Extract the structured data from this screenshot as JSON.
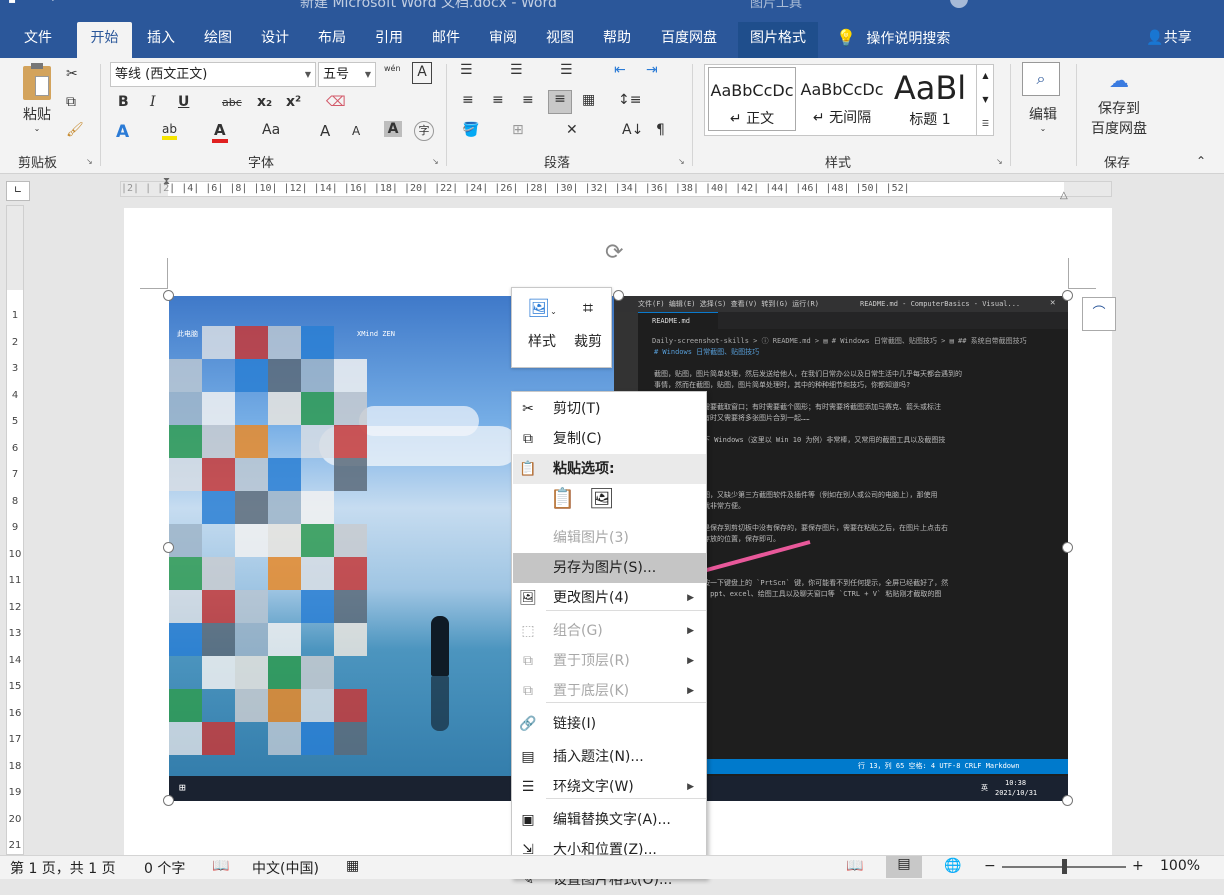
{
  "titlebar": {
    "doc_title": "新建 Microsoft Word 文档.docx - Word",
    "context_title": "图片工具"
  },
  "tabs": [
    "文件",
    "开始",
    "插入",
    "绘图",
    "设计",
    "布局",
    "引用",
    "邮件",
    "审阅",
    "视图",
    "帮助",
    "百度网盘",
    "图片格式"
  ],
  "active_tab": "开始",
  "tell_me": "操作说明搜索",
  "share": "共享",
  "clipboard": {
    "paste": "粘贴",
    "group": "剪贴板"
  },
  "font": {
    "name": "等线 (西文正文)",
    "size": "五号",
    "group": "字体",
    "bold": "B",
    "italic": "I",
    "underline": "U",
    "strike": "abc",
    "sub": "x₂",
    "sup": "x²",
    "grow": "A",
    "shrink": "A",
    "case": "Aa",
    "phonetic": "wén"
  },
  "paragraph": {
    "group": "段落"
  },
  "styles": {
    "group": "样式",
    "items": [
      {
        "sample": "AaBbCcDc",
        "name": "正文"
      },
      {
        "sample": "AaBbCcDc",
        "name": "无间隔"
      },
      {
        "sample": "AaBl",
        "name": "标题 1"
      }
    ]
  },
  "editing": {
    "label": "编辑"
  },
  "save": {
    "line1": "保存到",
    "line2": "百度网盘",
    "group": "保存"
  },
  "ruler_text": "|2|  |  |2|  |4|  |6|  |8|  |10|  |12|  |14|  |16|  |18|  |20|  |22|  |24|  |26|  |28|  |30|  |32|  |34|  |36|  |38|  |40|  |42|  |44|  |46|  |48|  |50|  |52|",
  "vruler_numbers": [
    "1",
    "2",
    "3",
    "4",
    "5",
    "6",
    "7",
    "8",
    "9",
    "10",
    "11",
    "12",
    "13",
    "14",
    "15",
    "16",
    "17",
    "18",
    "19",
    "20",
    "21"
  ],
  "minibar": {
    "style": "样式",
    "crop": "裁剪"
  },
  "context_menu": [
    {
      "label": "剪切(T)",
      "icon": "✂",
      "disabled": false,
      "sub": false
    },
    {
      "label": "复制(C)",
      "icon": "⧉",
      "disabled": false,
      "sub": false
    },
    {
      "label": "粘贴选项:",
      "icon": "📋",
      "disabled": false,
      "sub": false,
      "header": true
    },
    {
      "label": "编辑图片(3)",
      "icon": "",
      "disabled": true,
      "sub": false
    },
    {
      "label": "另存为图片(S)...",
      "icon": "",
      "disabled": false,
      "sub": false,
      "highlight": true
    },
    {
      "label": "更改图片(4)",
      "icon": "🖼",
      "disabled": false,
      "sub": true
    },
    {
      "label": "组合(G)",
      "icon": "⬚",
      "disabled": true,
      "sub": true
    },
    {
      "label": "置于顶层(R)",
      "icon": "⧉",
      "disabled": true,
      "sub": true
    },
    {
      "label": "置于底层(K)",
      "icon": "⧉",
      "disabled": true,
      "sub": true
    },
    {
      "label": "链接(I)",
      "icon": "🔗",
      "disabled": false,
      "sub": false
    },
    {
      "label": "插入题注(N)...",
      "icon": "▤",
      "disabled": false,
      "sub": false
    },
    {
      "label": "环绕文字(W)",
      "icon": "☰",
      "disabled": false,
      "sub": true
    },
    {
      "label": "编辑替换文字(A)...",
      "icon": "▣",
      "disabled": false,
      "sub": false
    },
    {
      "label": "大小和位置(Z)...",
      "icon": "⇲",
      "disabled": false,
      "sub": false
    },
    {
      "label": "设置图片格式(O)...",
      "icon": "✎",
      "disabled": false,
      "sub": false
    }
  ],
  "status": {
    "page": "第 1 页，共 1 页",
    "words": "0 个字",
    "lang": "中文(中国)",
    "zoom": "100%"
  },
  "screenshot": {
    "desktop_icons": [
      "此电脑",
      "",
      "",
      "",
      "XMind ZEN"
    ],
    "vscode_tab": "README.md",
    "vscode_title": "README.md - ComputerBasics - Visual...",
    "vscode_menu": "文件(F)  编辑(E)  选择(S)  查看(V)  转到(G)  运行(R)",
    "breadcrumb": "Daily-screenshot-skills > ⓘ README.md > ▤ # Windows 日常截图、贴图技巧 > ▤ ## 系统自带截图技巧",
    "code_lines": [
      "# Windows 日常截图、贴图技巧",
      "",
      "截图，贴图，图片简单处理，然后发送给他人，在我们日常办公以及日常生活中几乎每天都会遇到的",
      "事情，然而在截图，贴图，图片简单处理时，其中的种种细节和技巧，你都知道吗?",
      "",
      "要截全屏；有时需要截取窗口；有时需要截个圆形；有时需要将截图添加马赛克、箭头或标注",
      "时需要截长图；有时又需要将多张图片合到一起……",
      "",
      "们来简单介绍一下 Windows（这里以 Win 10 为例）非常棒，又常用的截图工具以及截图技",
      "",
      "",
      "自带截图技巧",
      "",
      "们需要快速的截图，又缺少第三方截图软件及插件等（例如在别人或公司的电脑上），那使用",
      "带的截图技巧，就非常方便。",
      "",
      "系统截图，图片是保存到剪切板中没有保存的，要保存图片，需要在粘贴之后，在图片上点击右",
      "图片另存，选择存放的位置，保存即可。",
      "",
      "键截全屏",
      "",
      "方法，就是直接按一下键盘上的 `PrtScn` 键，你可能看不到任何提示，全屏已经截好了，然",
      "可以打开 word、ppt、excel、绘图工具以及聊天窗口等 `CTRL + V` 粘贴刚才截取的图"
    ],
    "vscode_status": "行 13，列 65   空格: 4   UTF-8   CRLF   Markdown",
    "clock_time": "10:38",
    "clock_date": "2021/10/31",
    "tray_lang": "英"
  }
}
